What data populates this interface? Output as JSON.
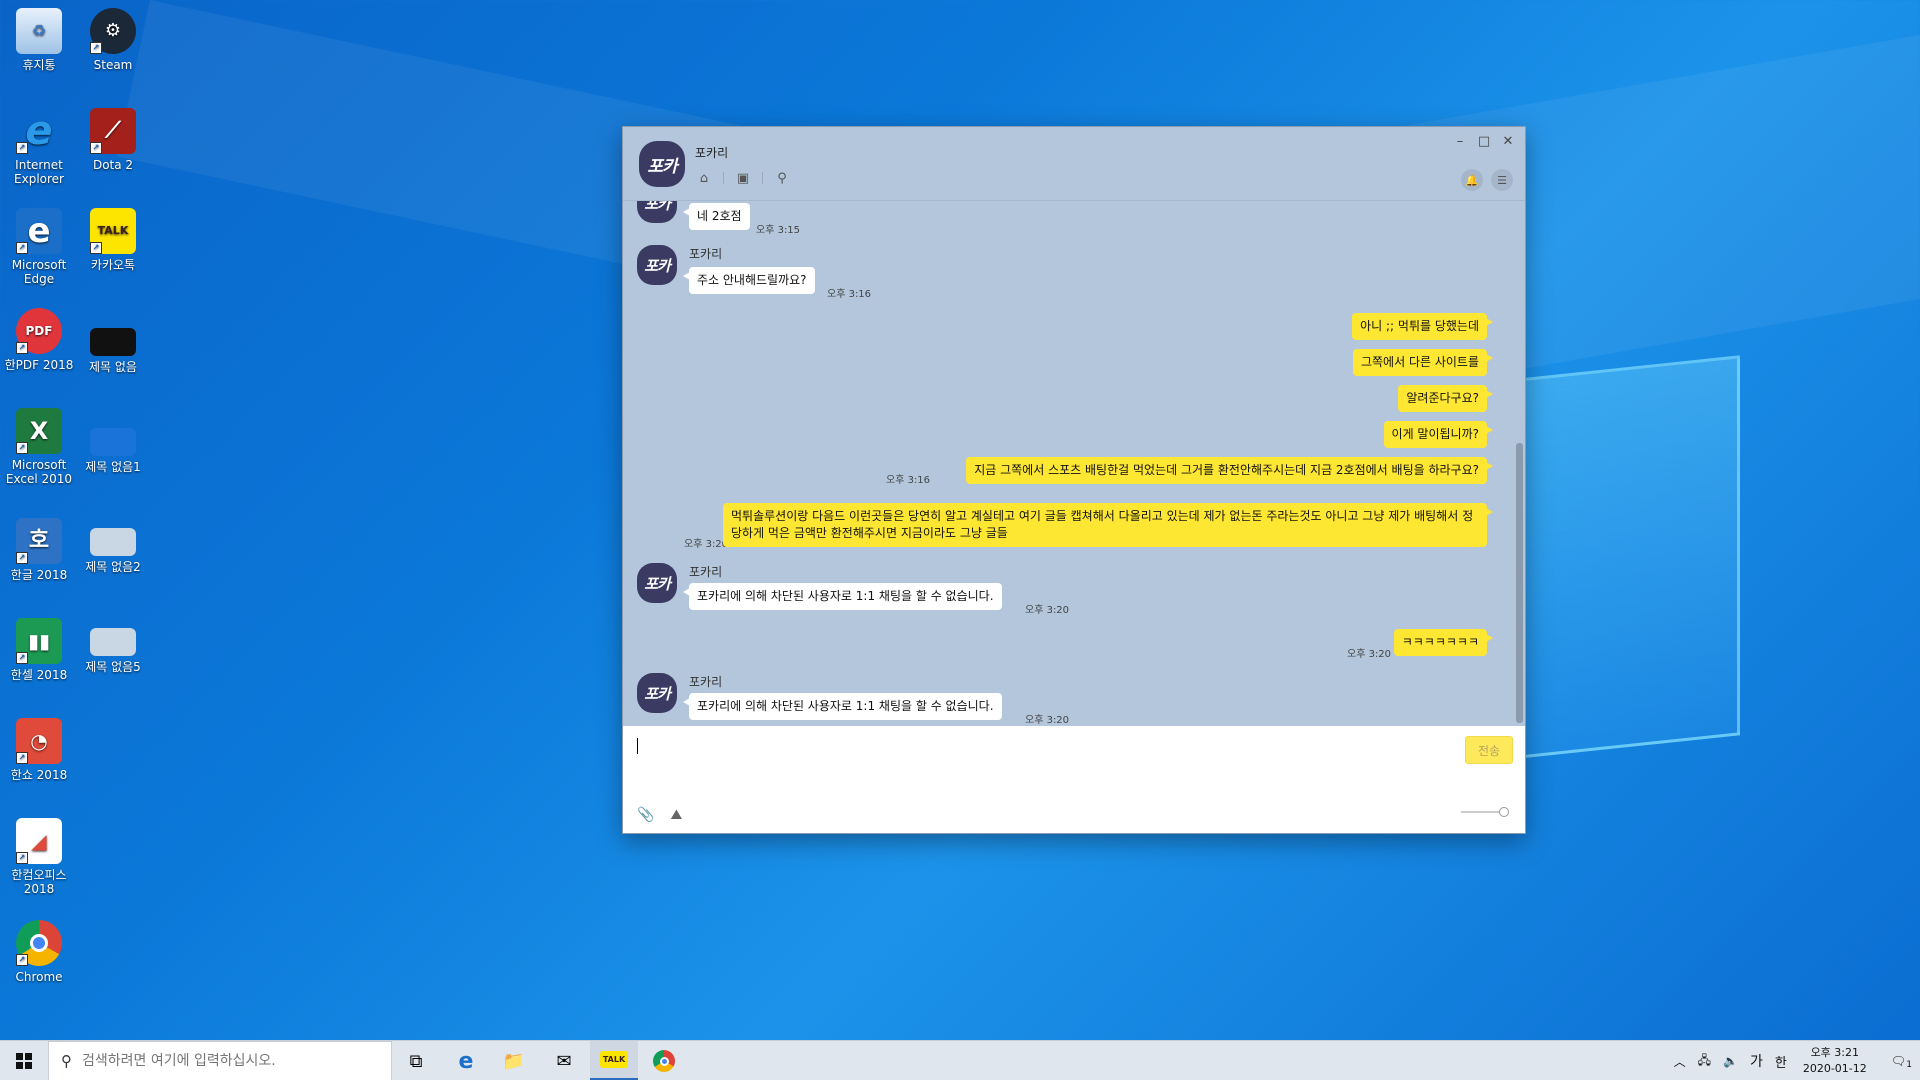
{
  "desktop": {
    "icons": [
      {
        "label": "휴지통",
        "icon": "recycle-bin-icon"
      },
      {
        "label": "Steam",
        "icon": "steam-icon"
      },
      {
        "label": "Internet Explorer",
        "icon": "internet-explorer-icon"
      },
      {
        "label": "Dota 2",
        "icon": "dota2-icon"
      },
      {
        "label": "Microsoft Edge",
        "icon": "edge-icon"
      },
      {
        "label": "카카오톡",
        "icon": "kakaotalk-icon"
      },
      {
        "label": "한PDF 2018",
        "icon": "hanpdf-icon"
      },
      {
        "label": "제목 없음",
        "icon": "image-file-icon"
      },
      {
        "label": "Microsoft Excel 2010",
        "icon": "excel-icon"
      },
      {
        "label": "제목 없음1",
        "icon": "image-file-icon"
      },
      {
        "label": "한글 2018",
        "icon": "hangul-icon"
      },
      {
        "label": "제목 없음2",
        "icon": "image-file-icon"
      },
      {
        "label": "한셀 2018",
        "icon": "hancell-icon"
      },
      {
        "label": "제목 없음5",
        "icon": "image-file-icon"
      },
      {
        "label": "한쇼 2018",
        "icon": "hanshow-icon"
      },
      {
        "label": "한컴오피스 2018",
        "icon": "hancom-office-icon"
      },
      {
        "label": "Chrome",
        "icon": "chrome-icon"
      }
    ]
  },
  "chat": {
    "title": "포카리",
    "avatar_text": "포카",
    "send_label": "전송",
    "messages": [
      {
        "from": "other",
        "text": "네 2호점",
        "time": "오후 3:15"
      },
      {
        "from": "other",
        "sender": "포카리",
        "text": "주소 안내해드릴까요?",
        "time": "오후 3:16"
      },
      {
        "from": "me",
        "text": "아니 ;; 먹튀를 당했는데"
      },
      {
        "from": "me",
        "text": "그쪽에서 다른 사이트를"
      },
      {
        "from": "me",
        "text": "알려준다구요?"
      },
      {
        "from": "me",
        "text": "이게 말이됩니까?"
      },
      {
        "from": "me",
        "text": "지금 그쪽에서 스포츠 배팅한걸 먹었는데 그거를 환전안해주시는데 지금 2호점에서 배팅을 하라구요?",
        "time": "오후 3:16"
      },
      {
        "from": "me",
        "text": "먹튀솔루션이랑 다음드 이런곳들은 당연히 알고 계실테고 여기 글들 캡쳐해서 다올리고 있는데 제가 없는돈 주라는것도 아니고 그냥 제가 배팅해서 정당하게 먹은 금액만 환전해주시면 지금이라도 그냥 글들",
        "time": "오후 3:20"
      },
      {
        "from": "other",
        "sender": "포카리",
        "text": "포카리에 의해 차단된 사용자로 1:1 채팅을 할 수 없습니다.",
        "time": "오후 3:20"
      },
      {
        "from": "me",
        "text": "ㅋㅋㅋㅋㅋㅋㅋ",
        "time": "오후 3:20"
      },
      {
        "from": "other",
        "sender": "포카리",
        "text": "포카리에 의해 차단된 사용자로 1:1 채팅을 할 수 없습니다.",
        "time": "오후 3:20"
      }
    ]
  },
  "taskbar": {
    "search_placeholder": "검색하려면 여기에 입력하십시오.",
    "ime_mode": "가",
    "ime_lang": "한",
    "clock_time": "오후 3:21",
    "clock_date": "2020-01-12",
    "notification_count": "1"
  }
}
